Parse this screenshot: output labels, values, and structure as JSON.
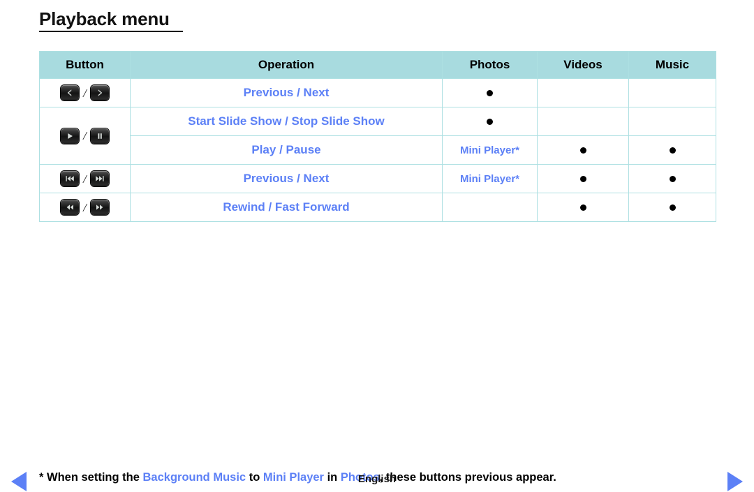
{
  "page": {
    "title": "Playback menu",
    "footer_language": "English"
  },
  "table": {
    "headers": [
      {
        "key": "button",
        "label": "Button"
      },
      {
        "key": "operation",
        "label": "Operation"
      },
      {
        "key": "photos",
        "label": "Photos"
      },
      {
        "key": "videos",
        "label": "Videos"
      },
      {
        "key": "music",
        "label": "Music"
      }
    ],
    "rows": [
      {
        "button_icons": [
          "prev-chevron-icon",
          "next-chevron-icon"
        ],
        "button_separator": "/",
        "operations": [
          {
            "operation": "Previous / Next",
            "photos": "dot",
            "videos": "",
            "music": ""
          }
        ]
      },
      {
        "button_icons": [
          "play-icon",
          "pause-icon"
        ],
        "button_separator": "/",
        "operations": [
          {
            "operation": "Start Slide Show / Stop Slide Show",
            "photos": "dot",
            "videos": "",
            "music": ""
          },
          {
            "operation": "Play / Pause",
            "photos": "Mini Player*",
            "videos": "dot",
            "music": "dot"
          }
        ]
      },
      {
        "button_icons": [
          "skip-backward-icon",
          "skip-forward-icon"
        ],
        "button_separator": "/",
        "operations": [
          {
            "operation": "Previous / Next",
            "photos": "Mini Player*",
            "videos": "dot",
            "music": "dot"
          }
        ]
      },
      {
        "button_icons": [
          "rewind-icon",
          "fast-forward-icon"
        ],
        "button_separator": "/",
        "operations": [
          {
            "operation": "Rewind / Fast Forward",
            "photos": "",
            "videos": "dot",
            "music": "dot"
          }
        ]
      }
    ]
  },
  "footnote": {
    "segments": [
      {
        "text": "* When setting the ",
        "highlight": false
      },
      {
        "text": "Background Music",
        "highlight": true
      },
      {
        "text": " to ",
        "highlight": false
      },
      {
        "text": "Mini Player",
        "highlight": true
      },
      {
        "text": " in ",
        "highlight": false
      },
      {
        "text": "Photos",
        "highlight": true
      },
      {
        "text": ", these buttons previous appear.",
        "highlight": false
      }
    ],
    "prev_arrow_icon": "triangle-left-icon",
    "next_arrow_icon": "triangle-right-icon"
  },
  "colors": {
    "header_bg": "#a8dbdf",
    "border": "#ade0e2",
    "accent_blue": "#5c80f6",
    "text": "#000000"
  }
}
